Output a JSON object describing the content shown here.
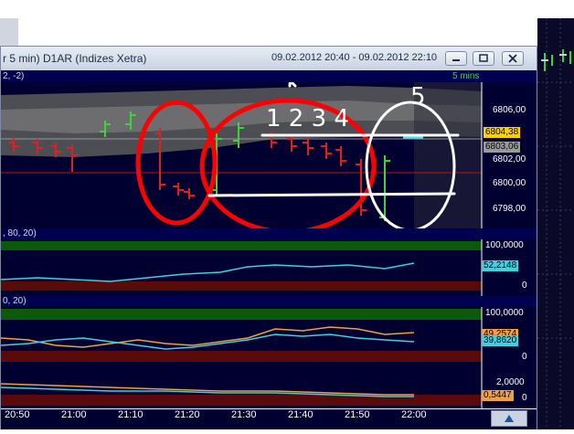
{
  "window": {
    "title": "r 5 min)  D1AR (Indizes Xetra)",
    "date_range": "09.02.2012 20:40 - 09.02.2012 22:10",
    "minimize_icon": "minimize-icon",
    "restore_icon": "restore-icon",
    "close_icon": "close-icon"
  },
  "price_pane": {
    "header_label": "2, -2)",
    "interval_label": "5 mins",
    "y_labels": [
      "6806,00",
      "6804,00",
      "6802,00",
      "6800,00",
      "6798,00"
    ],
    "last_price": "6804,38",
    "ref_price": "6803,06",
    "annotations": {
      "count_text": "1 2 3 4",
      "five_text": "5"
    }
  },
  "osc1": {
    "header_label": ", 80, 20)",
    "y_top": "100,0000",
    "value": "52,2148",
    "y_bottom": "0"
  },
  "osc2": {
    "header_label": "0, 20)",
    "y_top": "100,0000",
    "value_a": "49,2574",
    "value_b": "39,8620",
    "y_bottom": "0"
  },
  "osc3": {
    "y_top": "2,0000",
    "value": "0,5447",
    "y_bottom": "0"
  },
  "time_axis": {
    "labels": [
      "20:50",
      "21:00",
      "21:10",
      "21:20",
      "21:30",
      "21:40",
      "21:50",
      "22:00"
    ]
  },
  "colors": {
    "pane_bg": "#000030",
    "bull": "#40d040",
    "bear": "#e02020",
    "band": "#6a6a6a",
    "annotation_red": "#ff0000",
    "annotation_white": "#ffffff"
  }
}
